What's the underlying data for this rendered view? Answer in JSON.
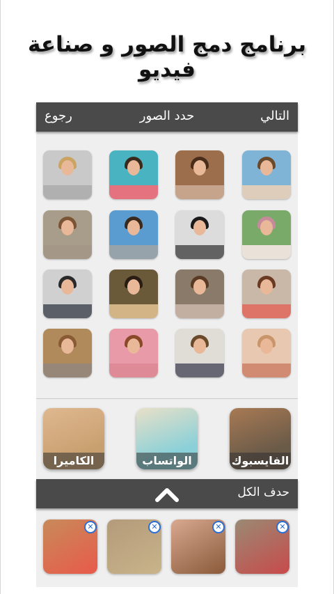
{
  "headline": "برنامج دمج الصور و صناعة فيديو",
  "header": {
    "next_label": "التالي",
    "title": "حدد الصور",
    "back_label": "رجوع"
  },
  "photo_grid": {
    "rows": [
      [
        {
          "sky": "#c9c9c9",
          "hair": "#c9a463",
          "ground": "#9b9b9b"
        },
        {
          "sky": "#4ab3c2",
          "hair": "#3a2a1e",
          "ground": "#e24a5a"
        },
        {
          "sky": "#9c6e4c",
          "hair": "#4a2c1a",
          "ground": "#b88a6a"
        },
        {
          "sky": "#7fb4d6",
          "hair": "#6b4a2c",
          "ground": "#d8c2a8"
        }
      ],
      [
        {
          "sky": "#a89c8a",
          "hair": "#7a5434",
          "ground": "#8c7a66"
        },
        {
          "sky": "#5a9bd0",
          "hair": "#3a2a1e",
          "ground": "#7a8a94"
        },
        {
          "sky": "#dcdcdc",
          "hair": "#1a1a1a",
          "ground": "#333333"
        },
        {
          "sky": "#7aaa6a",
          "hair": "#c78a9a",
          "ground": "#e8dcd0"
        }
      ],
      [
        {
          "sky": "#d0d0d0",
          "hair": "#2a2a2a",
          "ground": "#2a2f3a"
        },
        {
          "sky": "#6a5a3a",
          "hair": "#2a1e14",
          "ground": "#c9a063"
        },
        {
          "sky": "#8a7a6a",
          "hair": "#5a3a24",
          "ground": "#b49a88"
        },
        {
          "sky": "#c9b8a8",
          "hair": "#6a3a22",
          "ground": "#d84a3a"
        }
      ],
      [
        {
          "sky": "#b08a5a",
          "hair": "#8a5a34",
          "ground": "#7a6450"
        },
        {
          "sky": "#e89aa8",
          "hair": "#8a4a2a",
          "ground": "#d86a7a"
        },
        {
          "sky": "#e0dcd6",
          "hair": "#6a4a2a",
          "ground": "#3a3a4a"
        },
        {
          "sky": "#e8c8b0",
          "hair": "#c8966a",
          "ground": "#c86a4a"
        }
      ]
    ]
  },
  "sources": [
    {
      "label": "الفايسبوك",
      "bg": "#6a5a48",
      "accent": "#a87a54"
    },
    {
      "label": "الواتساب",
      "bg": "#8ad0d8",
      "accent": "#e8e0c8"
    },
    {
      "label": "الكاميرا",
      "bg": "#c8a070",
      "accent": "#e0b890"
    }
  ],
  "actions": {
    "delete_all_label": "حدف الكل",
    "collapse_icon": "chevron-up-icon"
  },
  "selected": [
    {
      "bg": "#c88a5a",
      "accent": "#e85a4a",
      "remove_glyph": "✕"
    },
    {
      "bg": "#b49a7a",
      "accent": "#c8b48a",
      "remove_glyph": "✕"
    },
    {
      "bg": "#d8a890",
      "accent": "#8a5a3a",
      "remove_glyph": "✕"
    },
    {
      "bg": "#9a8a74",
      "accent": "#c84a4a",
      "remove_glyph": "✕"
    }
  ],
  "colors": {
    "bar": "#4a4a4a",
    "panel": "#efefef",
    "remove_icon": "#2b6fd6"
  }
}
